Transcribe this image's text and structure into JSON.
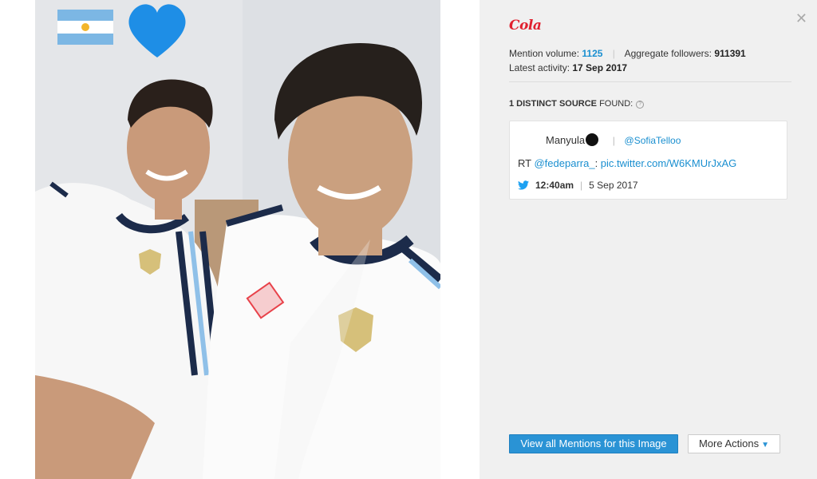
{
  "panel": {
    "close_icon": "close-icon",
    "brand_logo_text": "Cola",
    "mention_volume_label": "Mention volume:",
    "mention_volume_value": "1125",
    "aggregate_followers_label": "Aggregate followers:",
    "aggregate_followers_value": "911391",
    "latest_activity_label": "Latest activity:",
    "latest_activity_value": "17 Sep 2017",
    "sources_count_bold": "1 DISTINCT SOURCE",
    "sources_found": " FOUND:"
  },
  "mention": {
    "author": "Manyula",
    "handle": "@SofiaTelloo",
    "text_prefix": "RT ",
    "text_mention": "@fedeparra_",
    "text_colon": ": ",
    "text_link": "pic.twitter.com/W6KMUrJxAG",
    "time": "12:40am",
    "date": "5 Sep 2017",
    "source_icon": "twitter-icon"
  },
  "actions": {
    "view_all": "View all Mentions for this Image",
    "more_actions": "More Actions"
  },
  "colors": {
    "accent": "#2a93d5",
    "link": "#1a8fd0",
    "brand": "#e0212f",
    "detection_box": "#e8424a"
  }
}
